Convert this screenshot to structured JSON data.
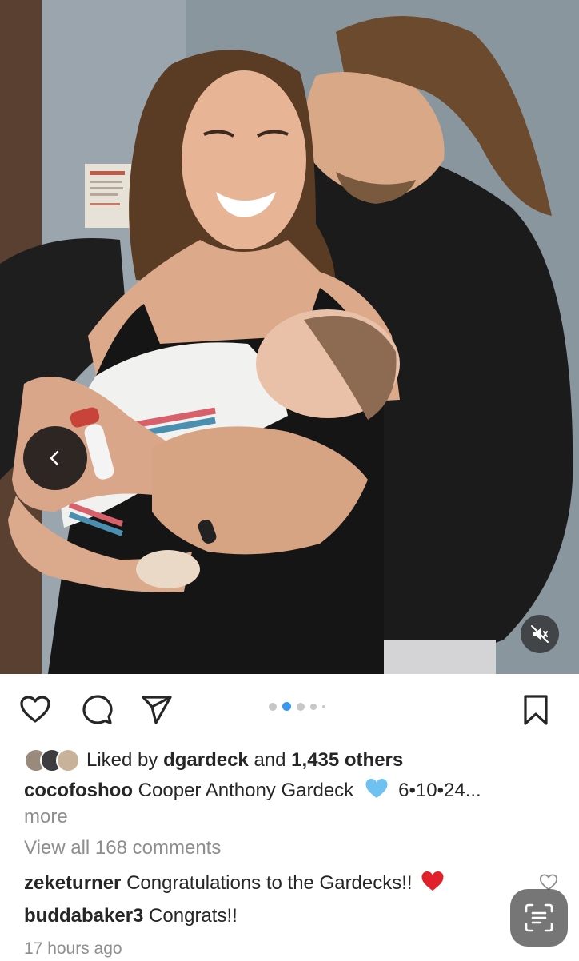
{
  "post": {
    "carousel": {
      "dot_count": 5,
      "active_index": 1
    },
    "likes": {
      "prefix": "Liked by",
      "user": "dgardeck",
      "joiner": "and",
      "others": "1,435 others"
    },
    "caption": {
      "username": "cocofoshoo",
      "text": "Cooper Anthony Gardeck",
      "emoji": "blue-heart-icon",
      "date_text": "6•10•24...",
      "more_label": "more"
    },
    "view_all_comments": "View all 168 comments",
    "comments": [
      {
        "username": "zeketurner",
        "text": "Congratulations to the Gardecks!!",
        "emoji": "red-heart-icon"
      },
      {
        "username": "buddabaker3",
        "text": "Congrats!!"
      }
    ],
    "timestamp": "17 hours ago"
  },
  "colors": {
    "link_blue": "#3897f0",
    "muted_text": "#8e8e8e",
    "text": "#262626",
    "blue_heart": "#6ec1f0",
    "red_heart": "#e0202a"
  },
  "icons": {
    "prev": "chevron-left-icon",
    "mute": "speaker-muted-icon",
    "like": "heart-outline-icon",
    "comment": "speech-bubble-icon",
    "share": "paper-plane-icon",
    "save": "bookmark-icon",
    "scan": "text-scan-icon"
  }
}
